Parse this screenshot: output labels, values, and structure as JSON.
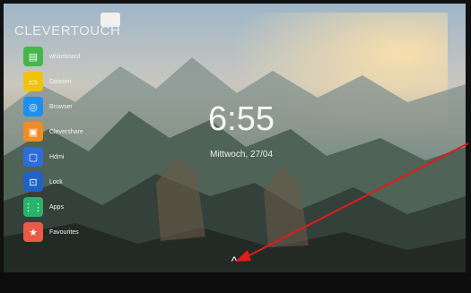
{
  "brand": "CLEVERTOUCH",
  "badge": "",
  "apps": [
    {
      "label": "whiteboard",
      "color": "#45b649",
      "icon": "whiteboard-icon"
    },
    {
      "label": "Dateien",
      "color": "#f0c20c",
      "icon": "folder-icon"
    },
    {
      "label": "Browser",
      "color": "#1f8ef1",
      "icon": "globe-icon"
    },
    {
      "label": "Clevershare",
      "color": "#f38b1f",
      "icon": "cart-icon"
    },
    {
      "label": "Hdmi",
      "color": "#2d6cdf",
      "icon": "monitor-icon"
    },
    {
      "label": "Lock",
      "color": "#1e63c6",
      "icon": "lock-icon"
    },
    {
      "label": "Apps",
      "color": "#29b36a",
      "icon": "grid-icon"
    },
    {
      "label": "Favourites",
      "color": "#ea5a44",
      "icon": "star-icon"
    }
  ],
  "clock": "6:55",
  "date": "Mittwoch, 27/04",
  "up_glyph": "^",
  "annotation_color": "#e21b1b"
}
